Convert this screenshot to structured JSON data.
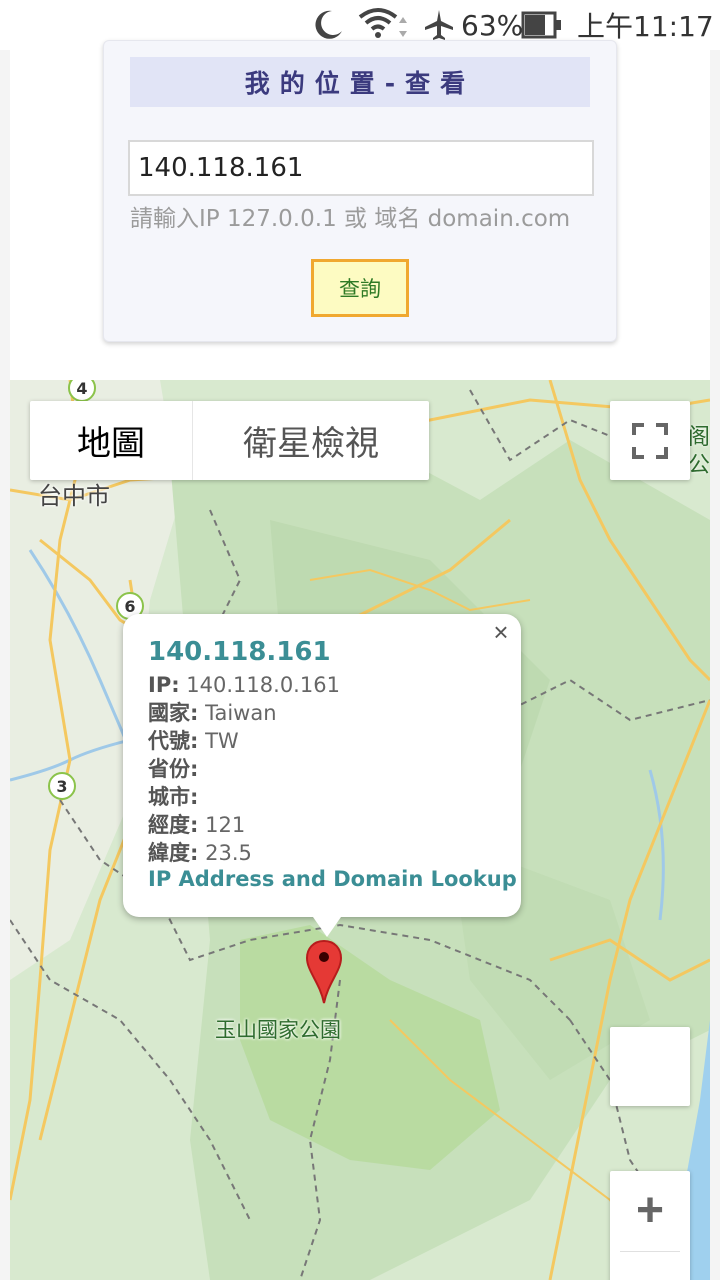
{
  "status_bar": {
    "battery_percent": "63%",
    "time": "上午11:17"
  },
  "lookup_form": {
    "title": "我的位置-查看",
    "ip_value": "140.118.161",
    "hint": "請輸入IP 127.0.0.1 或 域名 domain.com",
    "query_button": "查詢"
  },
  "map": {
    "type_tabs": [
      {
        "label": "地圖",
        "selected": true
      },
      {
        "label": "衛星檢視",
        "selected": false
      }
    ],
    "labels": {
      "city": "台中市",
      "park": "玉山國家公園",
      "edge": "阁\n公"
    },
    "route_shields": [
      "4",
      "6",
      "3"
    ],
    "zoom_in": "+"
  },
  "info_window": {
    "title": "140.118.161",
    "close": "×",
    "rows": [
      {
        "label": "IP:",
        "value": "140.118.0.161"
      },
      {
        "label": "國家:",
        "value": "Taiwan"
      },
      {
        "label": "代號:",
        "value": "TW"
      },
      {
        "label": "省份:",
        "value": ""
      },
      {
        "label": "城市:",
        "value": ""
      },
      {
        "label": "經度:",
        "value": "121"
      },
      {
        "label": "緯度:",
        "value": "23.5"
      }
    ],
    "link": "IP Address and Domain Lookup"
  },
  "colors": {
    "accent": "#3b8e95",
    "title_bg": "#e1e4f6",
    "button_bg": "#fdfbc2",
    "button_border": "#f0a830",
    "marker": "#e53935"
  }
}
